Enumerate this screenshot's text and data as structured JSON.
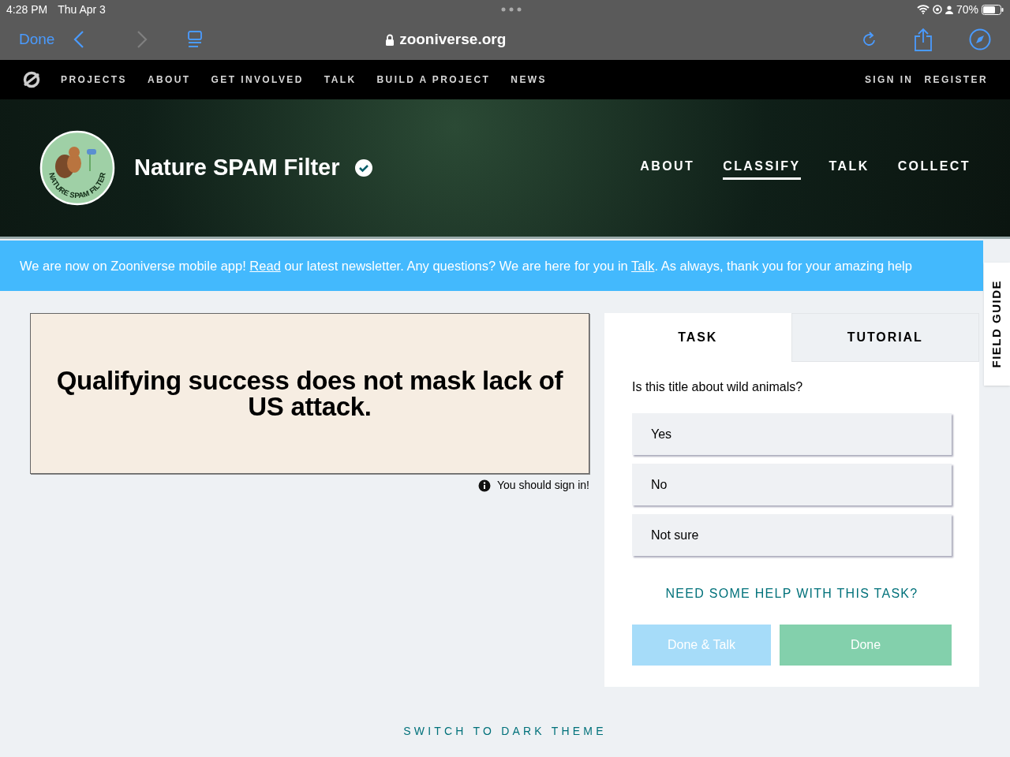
{
  "status_bar": {
    "time": "4:28 PM",
    "date": "Thu Apr 3",
    "battery": "70%"
  },
  "browser": {
    "done": "Done",
    "url": "zooniverse.org"
  },
  "site_nav": {
    "items": [
      "PROJECTS",
      "ABOUT",
      "GET INVOLVED",
      "TALK",
      "BUILD A PROJECT",
      "NEWS"
    ],
    "account": [
      "SIGN IN",
      "REGISTER"
    ]
  },
  "project": {
    "title": "Nature SPAM Filter",
    "logo_text": "NATURE SPAM FILTER",
    "verified": true,
    "tabs": [
      {
        "label": "ABOUT",
        "selected": false
      },
      {
        "label": "CLASSIFY",
        "selected": true
      },
      {
        "label": "TALK",
        "selected": false
      },
      {
        "label": "COLLECT",
        "selected": false
      }
    ]
  },
  "banner": [
    {
      "kind": "text",
      "text": "We are now on Zooniverse mobile app! "
    },
    {
      "kind": "link",
      "text": "Read"
    },
    {
      "kind": "text",
      "text": " our latest newsletter. Any questions? We are here for you in "
    },
    {
      "kind": "link",
      "text": "Talk"
    },
    {
      "kind": "text",
      "text": ". As always, thank you for your amazing help"
    }
  ],
  "subject": {
    "text": "Qualifying success does not mask lack of US attack.",
    "note": "You should sign in!"
  },
  "task_panel": {
    "tabs": [
      {
        "label": "TASK",
        "selected": true
      },
      {
        "label": "TUTORIAL",
        "selected": false
      }
    ],
    "question": "Is this title about wild animals?",
    "answers": [
      {
        "label": "Yes",
        "selected": false
      },
      {
        "label": "No",
        "selected": false
      },
      {
        "label": "Not sure",
        "selected": false
      }
    ],
    "help": "NEED SOME HELP WITH THIS TASK?",
    "buttons": [
      {
        "label": "Done & Talk",
        "kind": "talk"
      },
      {
        "label": "Done",
        "kind": "done"
      }
    ]
  },
  "field_guide": "FIELD GUIDE",
  "theme_toggle": "SWITCH TO DARK THEME"
}
